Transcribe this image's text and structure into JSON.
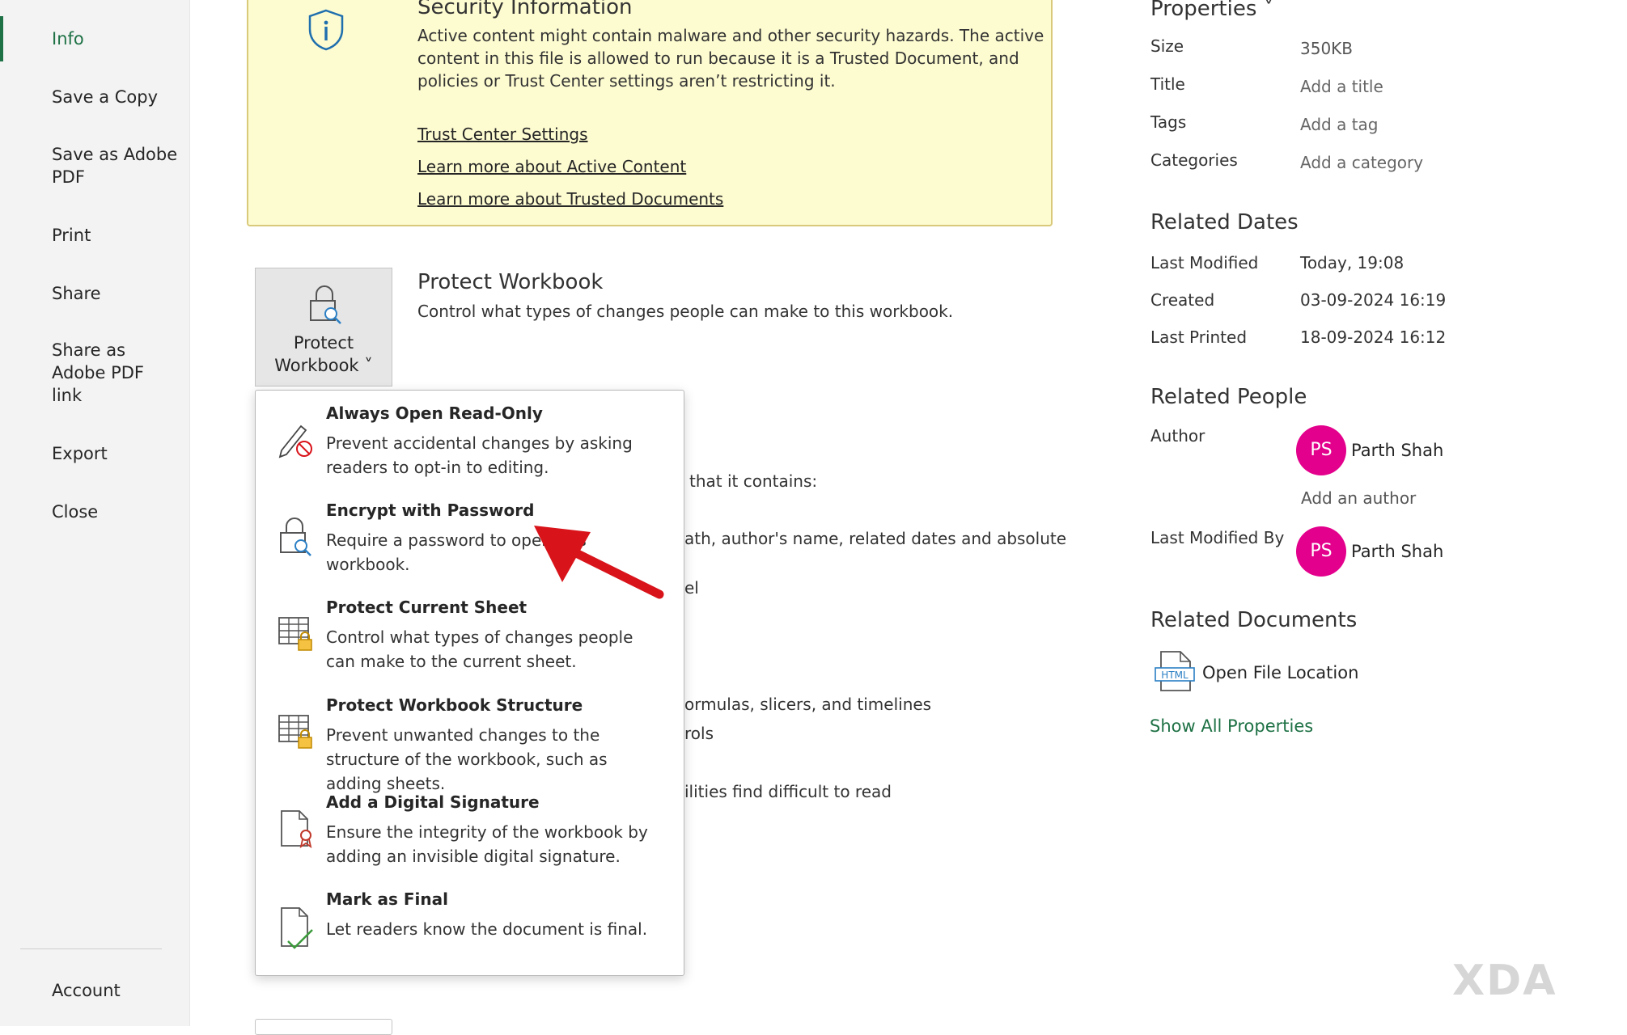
{
  "sidebar": {
    "items": [
      {
        "label": "Info"
      },
      {
        "label": "Save a Copy"
      },
      {
        "label": "Save as Adobe PDF"
      },
      {
        "label": "Print"
      },
      {
        "label": "Share"
      },
      {
        "label": "Share as Adobe PDF link"
      },
      {
        "label": "Export"
      },
      {
        "label": "Close"
      }
    ],
    "account_label": "Account"
  },
  "security": {
    "title": "Security Information",
    "text": "Active content might contain malware and other security hazards. The active content in this file is allowed to run because it is a Trusted Document, and policies or Trust Center settings aren’t restricting it.",
    "links": [
      "Trust Center Settings",
      "Learn more about Active Content",
      "Learn more about Trusted Documents"
    ]
  },
  "protect": {
    "button_line1": "Protect",
    "button_line2": "Workbook ˅",
    "title": "Protect Workbook",
    "description": "Control what types of changes people can make to this workbook."
  },
  "background_text": [
    "that it contains:",
    "ath, author's name, related dates and absolute",
    "el",
    "ormulas, slicers, and timelines",
    "rols",
    "ilities find difficult to read"
  ],
  "menu": [
    {
      "title": "Always Open Read-Only",
      "desc": "Prevent accidental changes by asking readers to opt-in to editing.",
      "icon": "pencil-no-edit-icon"
    },
    {
      "title": "Encrypt with Password",
      "desc": "Require a password to open this workbook.",
      "icon": "lock-key-icon"
    },
    {
      "title": "Protect Current Sheet",
      "desc": "Control what types of changes people can make to the current sheet.",
      "icon": "sheet-lock-icon"
    },
    {
      "title": "Protect Workbook Structure",
      "desc": "Prevent unwanted changes to the structure of the workbook, such as adding sheets.",
      "icon": "workbook-lock-icon"
    },
    {
      "title": "Add a Digital Signature",
      "desc": "Ensure the integrity of the workbook by adding an invisible digital signature.",
      "icon": "signature-ribbon-icon"
    },
    {
      "title": "Mark as Final",
      "desc": "Let readers know the document is final.",
      "icon": "document-check-icon"
    }
  ],
  "properties": {
    "heading": "Properties ˅",
    "rows": [
      {
        "label": "Size",
        "value": "350KB"
      },
      {
        "label": "Title",
        "value": "Add a title"
      },
      {
        "label": "Tags",
        "value": "Add a tag"
      },
      {
        "label": "Categories",
        "value": "Add a category"
      }
    ]
  },
  "related_dates": {
    "heading": "Related Dates",
    "rows": [
      {
        "label": "Last Modified",
        "value": "Today, 19:08"
      },
      {
        "label": "Created",
        "value": "03-09-2024 16:19"
      },
      {
        "label": "Last Printed",
        "value": "18-09-2024 16:12"
      }
    ]
  },
  "related_people": {
    "heading": "Related People",
    "author_label": "Author",
    "author_initials": "PS",
    "author_name": "Parth Shah",
    "add_author": "Add an author",
    "last_modified_by_label": "Last Modified By",
    "modifier_initials": "PS",
    "modifier_name": "Parth Shah"
  },
  "related_documents": {
    "heading": "Related Documents",
    "open_file_location": "Open File Location",
    "icon_text": "HTML"
  },
  "show_all_properties": "Show All Properties",
  "watermark": "XDA",
  "colors": {
    "accent": "#1e7145",
    "avatar": "#e3008c",
    "security_bg": "#fdfbd0",
    "arrow": "#d9131a"
  }
}
